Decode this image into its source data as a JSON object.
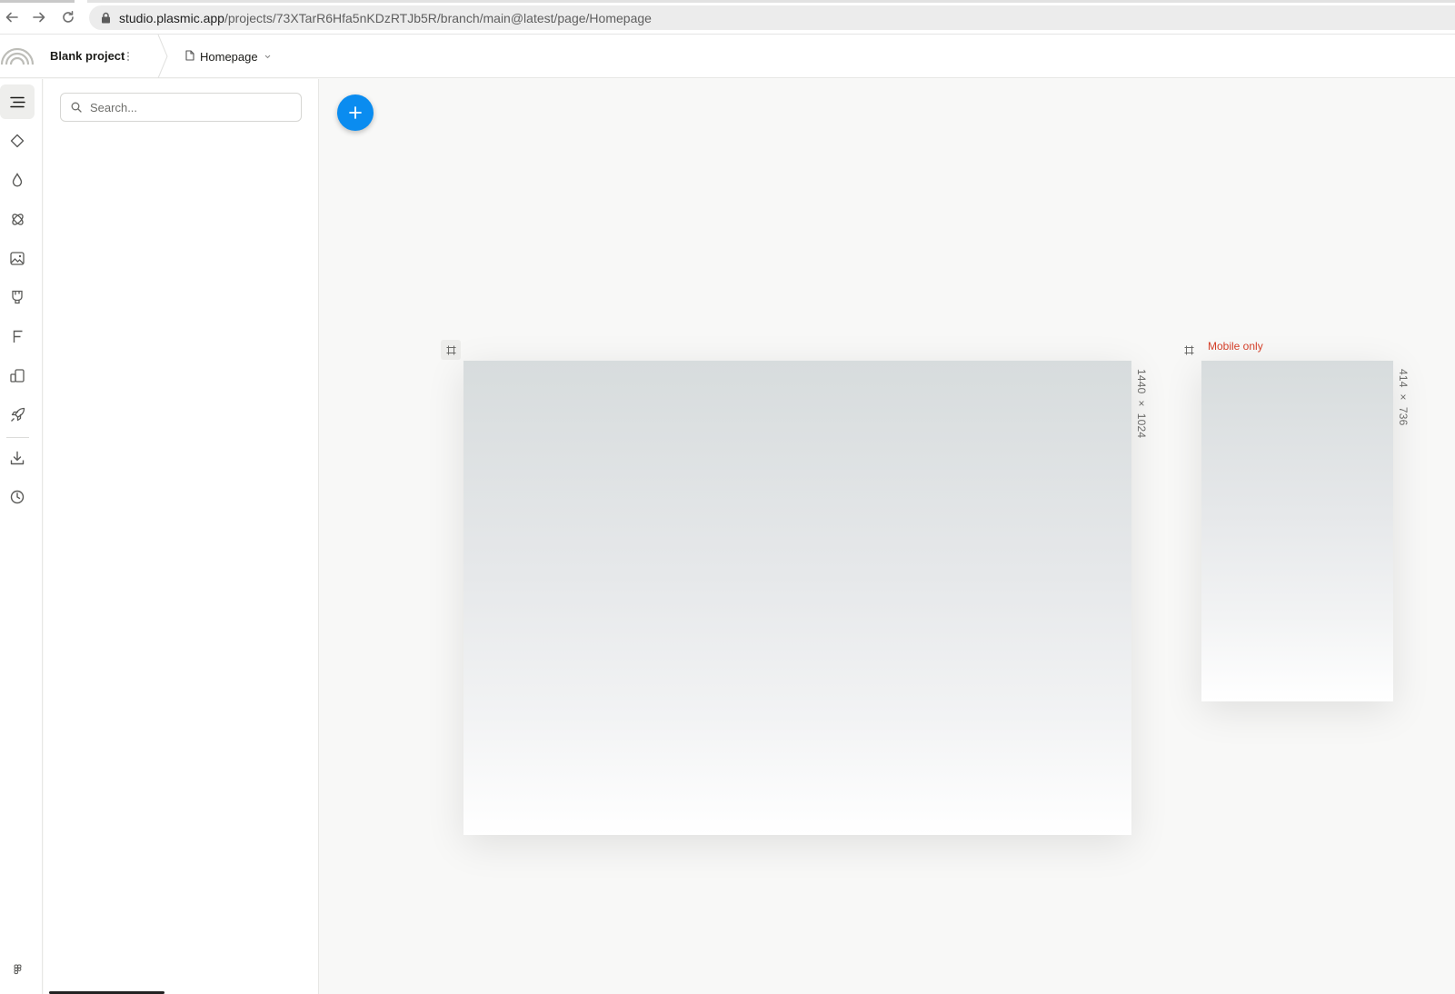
{
  "browser": {
    "url_host": "studio.plasmic.app",
    "url_path": "/projects/73XTarR6Hfa5nKDzRTJb5R/branch/main@latest/page/Homepage"
  },
  "header": {
    "project_name": "Blank project",
    "page_name": "Homepage"
  },
  "rail": {
    "items": [
      "outline-icon",
      "components-icon",
      "style-tokens-icon",
      "mixins-icon",
      "images-icon",
      "data-icon",
      "fonts-icon",
      "responsiveness-icon",
      "publish-icon",
      "import-icon",
      "history-icon"
    ]
  },
  "panel": {
    "search_placeholder": "Search..."
  },
  "canvas": {
    "desktop_frame": {
      "size_label": "1440 × 1024"
    },
    "mobile_frame": {
      "label": "Mobile only",
      "size_label": "414 × 736"
    }
  },
  "colors": {
    "accent": "#0a8cf0",
    "mobile_label": "#d6412b"
  }
}
